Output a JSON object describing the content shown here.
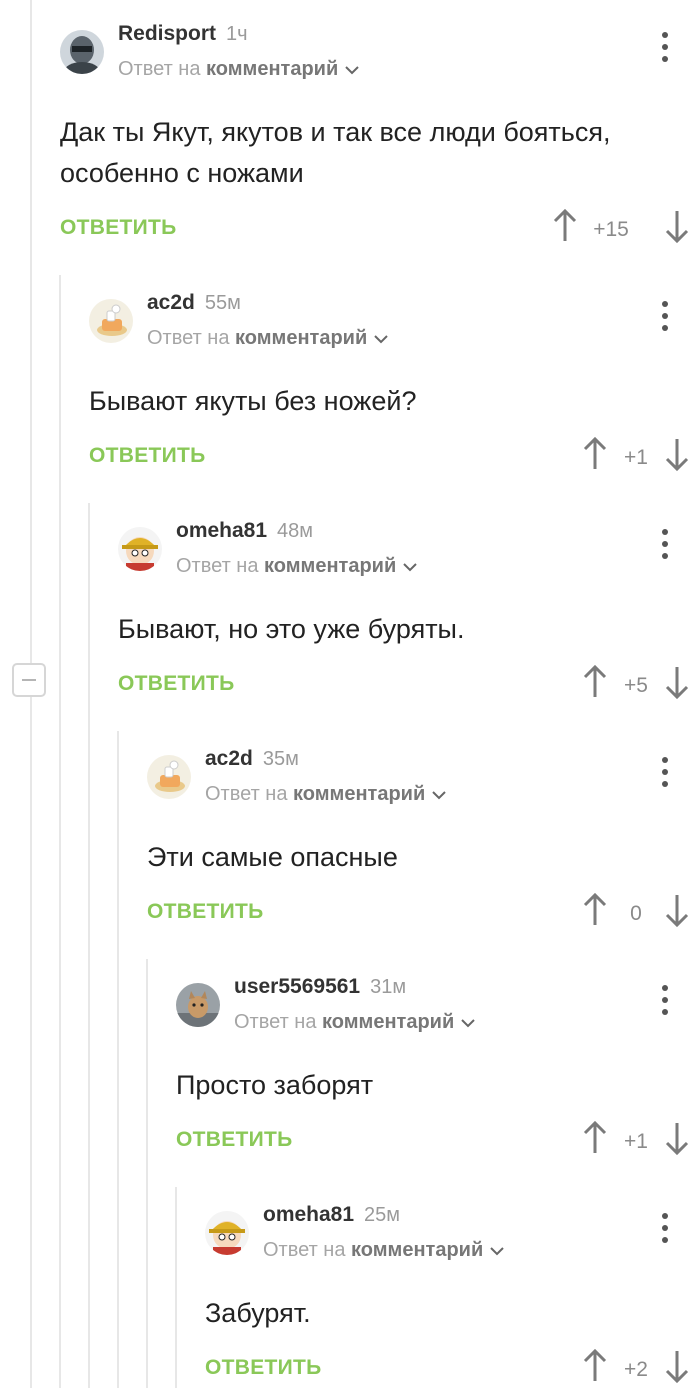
{
  "comments": [
    {
      "author": "Redisport",
      "time": "1ч",
      "reply_prefix": "Ответ на",
      "reply_target": "комментарий",
      "text": "Дак ты Якут, якутов и так все люди бояться, особенно с ножами",
      "reply_label": "ОТВЕТИТЬ",
      "score": "+15",
      "avatar": "robot-avatar"
    },
    {
      "author": "ac2d",
      "time": "55м",
      "reply_prefix": "Ответ на",
      "reply_target": "комментарий",
      "text": "Бывают якуты без ножей?",
      "reply_label": "ОТВЕТИТЬ",
      "score": "+1",
      "avatar": "cartoon-cake-avatar"
    },
    {
      "author": "omeha81",
      "time": "48м",
      "reply_prefix": "Ответ на",
      "reply_target": "комментарий",
      "text": "Бывают, но это уже буряты.",
      "reply_label": "ОТВЕТИТЬ",
      "score": "+5",
      "avatar": "south-park-character-avatar"
    },
    {
      "author": "ac2d",
      "time": "35м",
      "reply_prefix": "Ответ на",
      "reply_target": "комментарий",
      "text": "Эти самые опасные",
      "reply_label": "ОТВЕТИТЬ",
      "score": "0",
      "avatar": "cartoon-cake-avatar"
    },
    {
      "author": "user5569561",
      "time": "31м",
      "reply_prefix": "Ответ на",
      "reply_target": "комментарий",
      "text": "Просто заборят",
      "reply_label": "ОТВЕТИТЬ",
      "score": "+1",
      "avatar": "cat-photo-avatar"
    },
    {
      "author": "omeha81",
      "time": "25м",
      "reply_prefix": "Ответ на",
      "reply_target": "комментарий",
      "text": "Забурят.",
      "reply_label": "ОТВЕТИТЬ",
      "score": "+2",
      "avatar": "south-park-character-avatar"
    }
  ],
  "colors": {
    "accent": "#8ac858",
    "muted": "#a5a5a5",
    "text": "#222222",
    "thread_line": "#e7e7e7"
  }
}
